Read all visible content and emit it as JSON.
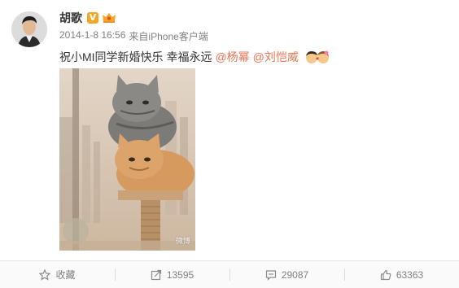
{
  "user": {
    "name": "胡歌",
    "verified_badge": "V"
  },
  "meta": {
    "timestamp": "2014-1-8 16:56",
    "source_prefix": "来自",
    "client": "iPhone客户端"
  },
  "post": {
    "text": "祝小MI同学新婚快乐 幸福永远",
    "mentions": [
      "@杨幂",
      "@刘恺威"
    ]
  },
  "image": {
    "watermark": "微博"
  },
  "actions": {
    "favorite_label": "收藏",
    "repost_count": "13595",
    "comment_count": "29087",
    "like_count": "63363"
  },
  "colors": {
    "mention": "#eb7350",
    "meta": "#808080",
    "badge": "#f5a623"
  }
}
